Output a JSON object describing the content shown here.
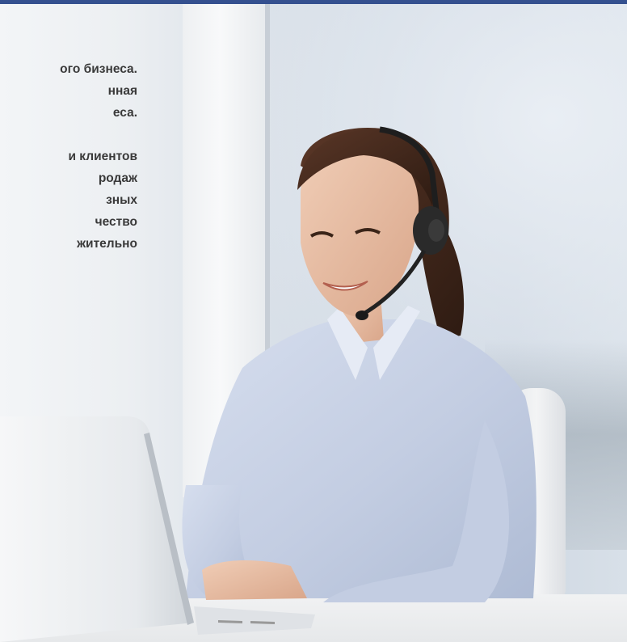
{
  "overlay_text": {
    "paragraph1": [
      "ого бизнеса.",
      "нная",
      "еса."
    ],
    "paragraph2": [
      "и клиентов",
      "родаж",
      "зных",
      "чество",
      "жительно"
    ]
  },
  "colors": {
    "top_bar": "#34508f",
    "text": "#3a3a3a",
    "shirt": "#c9d3e6",
    "hair": "#4a2d1f"
  },
  "icons": [
    "headset-icon"
  ]
}
